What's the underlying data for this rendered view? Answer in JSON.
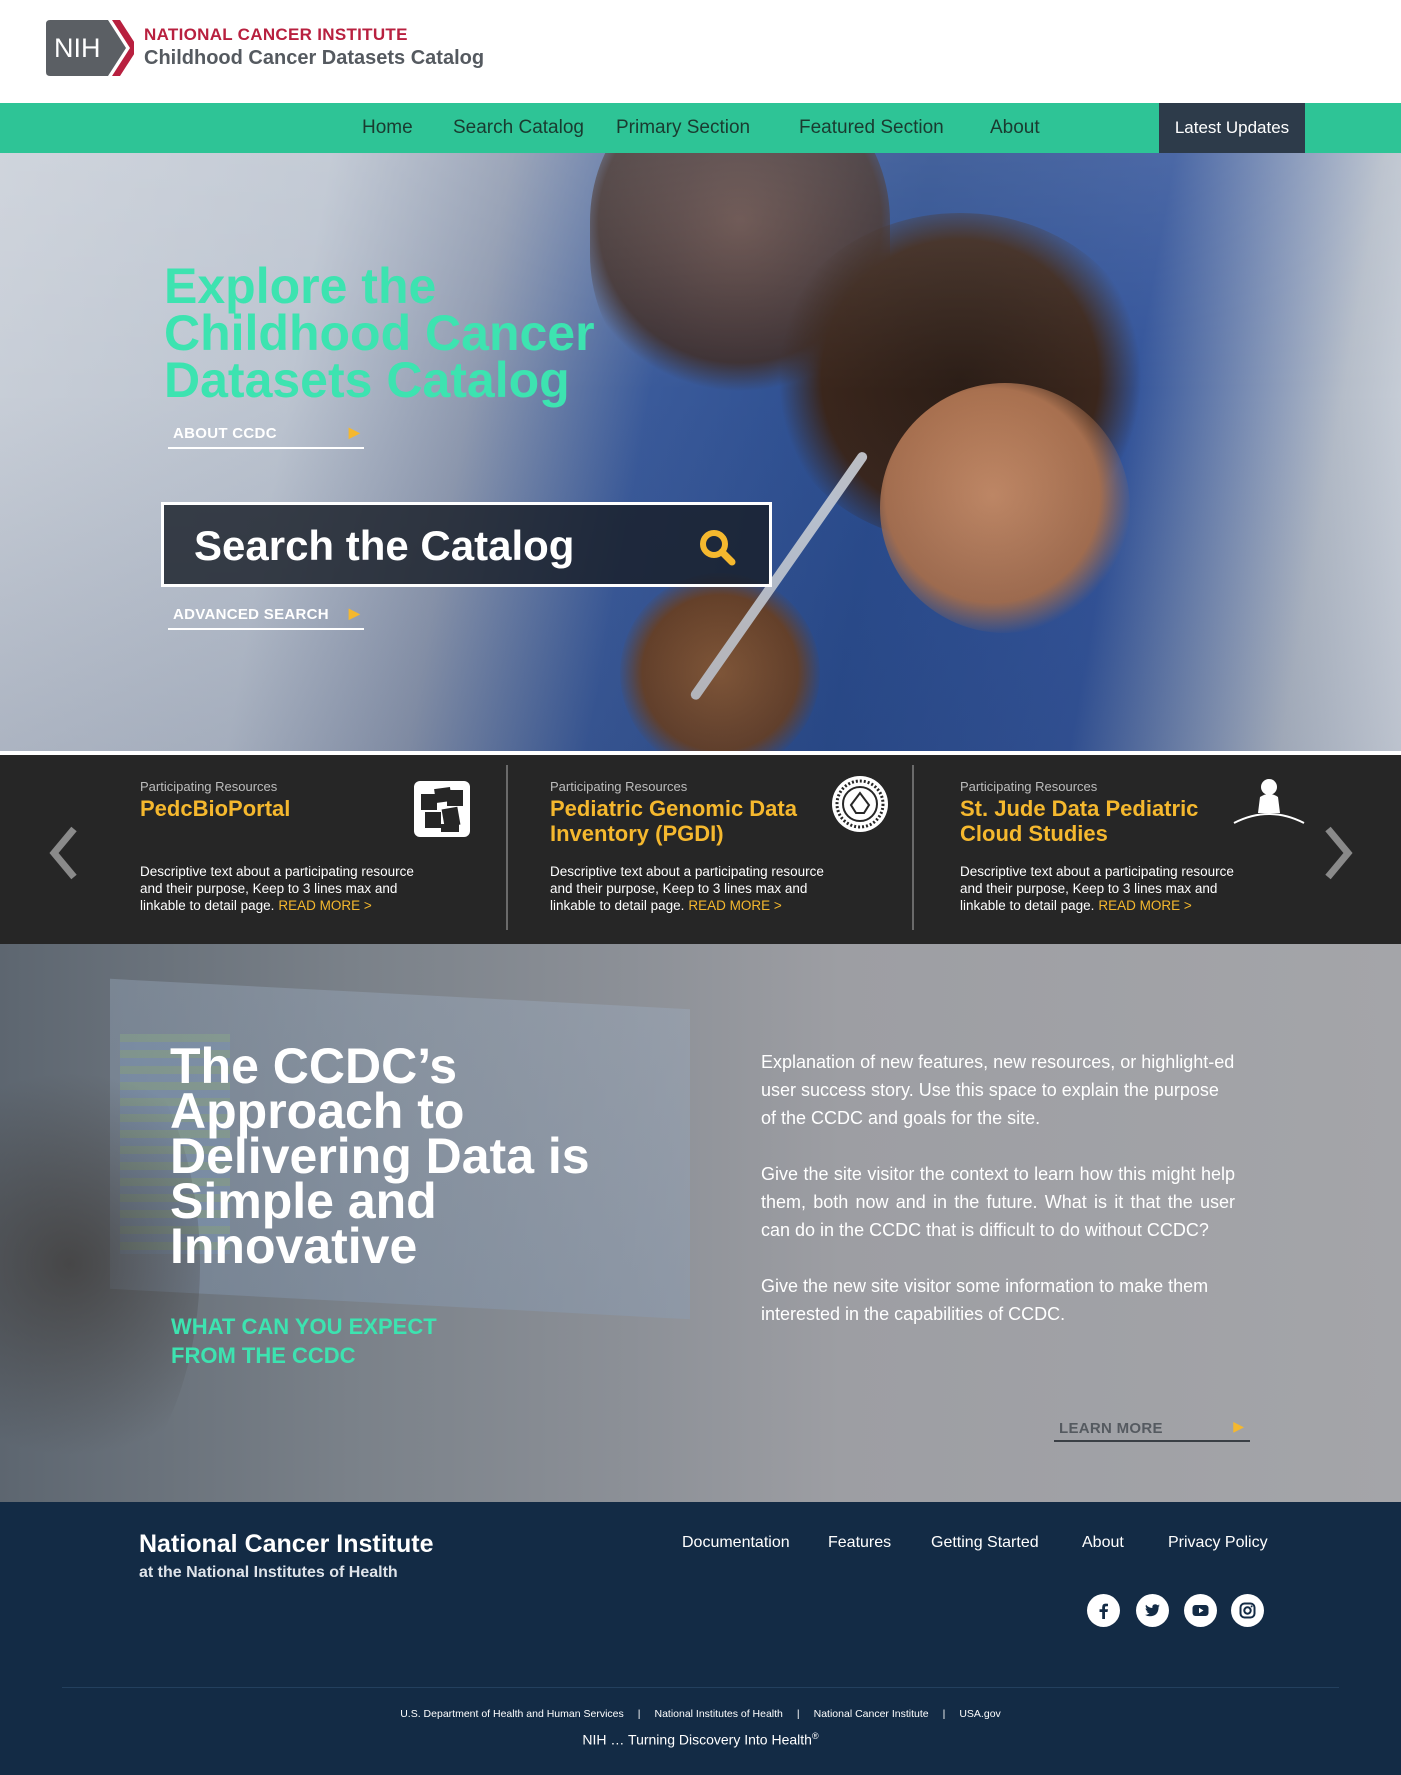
{
  "header": {
    "logo_text": "NIH",
    "institute": "NATIONAL CANCER INSTITUTE",
    "catalog_name": "Childhood Cancer Datasets Catalog"
  },
  "nav": {
    "items": [
      "Home",
      "Search Catalog",
      "Primary Section",
      "Featured Section",
      "About"
    ],
    "latest": "Latest Updates"
  },
  "hero": {
    "title_lines": [
      "Explore the",
      "Childhood Cancer",
      "Datasets Catalog"
    ],
    "about_link": "ABOUT CCDC",
    "search_label": "Search the Catalog",
    "advanced_link": "ADVANCED SEARCH"
  },
  "resources": {
    "cards": [
      {
        "kicker": "Participating Resources",
        "title_lines": [
          "PedcBioPortal"
        ],
        "desc": "Descriptive text about a participating resource and their purpose, Keep to 3 lines max and linkable to detail page.",
        "more": "READ MORE  >",
        "icon": "pedcbioportal-logo-icon"
      },
      {
        "kicker": "Participating Resources",
        "title_lines": [
          "Pediatric Genomic Data",
          "Inventory (PGDI)"
        ],
        "desc": "Descriptive text about a participating resource and their purpose, Keep to 3 lines max and linkable to detail page.",
        "more": "READ MORE  >",
        "icon": "pgdi-seal-icon"
      },
      {
        "kicker": "Participating Resources",
        "title_lines": [
          "St. Jude Data Pediatric",
          "Cloud Studies"
        ],
        "desc": "Descriptive text about a participating resource and their purpose, Keep to 3 lines max and linkable to detail page.",
        "more": "READ MORE  >",
        "icon": "st-jude-logo-icon"
      }
    ]
  },
  "approach": {
    "title_lines": [
      "The CCDC’s",
      "Approach to",
      "Delivering Data is",
      "Simple and",
      "Innovative"
    ],
    "kicker_lines": [
      "WHAT CAN YOU EXPECT",
      "FROM THE CCDC"
    ],
    "paragraphs": [
      "Explanation of new features, new resources, or highlight-ed user success story. Use this space to explain the purpose of the CCDC and goals for the site.",
      "Give the site visitor the context to learn how this might help them, both now and in the future. What is it that the user can do in the CCDC that is difficult to do without CCDC?",
      "Give the new site visitor some information to make them interested in the capabilities of CCDC."
    ],
    "learn_more": "LEARN MORE"
  },
  "footer": {
    "org": "National Cancer Institute",
    "org_sub": "at the National Institutes of Health",
    "links": [
      "Documentation",
      "Features",
      "Getting Started",
      "About",
      "Privacy Policy"
    ],
    "social": [
      "facebook-icon",
      "twitter-icon",
      "youtube-icon",
      "instagram-icon"
    ],
    "gov_links": [
      "U.S. Department of Health and Human  Services",
      "National Institutes of Health",
      "National Cancer Institute",
      "USA.gov"
    ],
    "tagline": "NIH … Turning Discovery Into Health",
    "tagline_mark": "®"
  },
  "colors": {
    "accent_green": "#2ec496",
    "hero_green": "#3de3b0",
    "gold": "#f5b82e",
    "brand_red": "#b8203f",
    "footer_navy": "#132b45",
    "strip_dark": "#262626"
  }
}
